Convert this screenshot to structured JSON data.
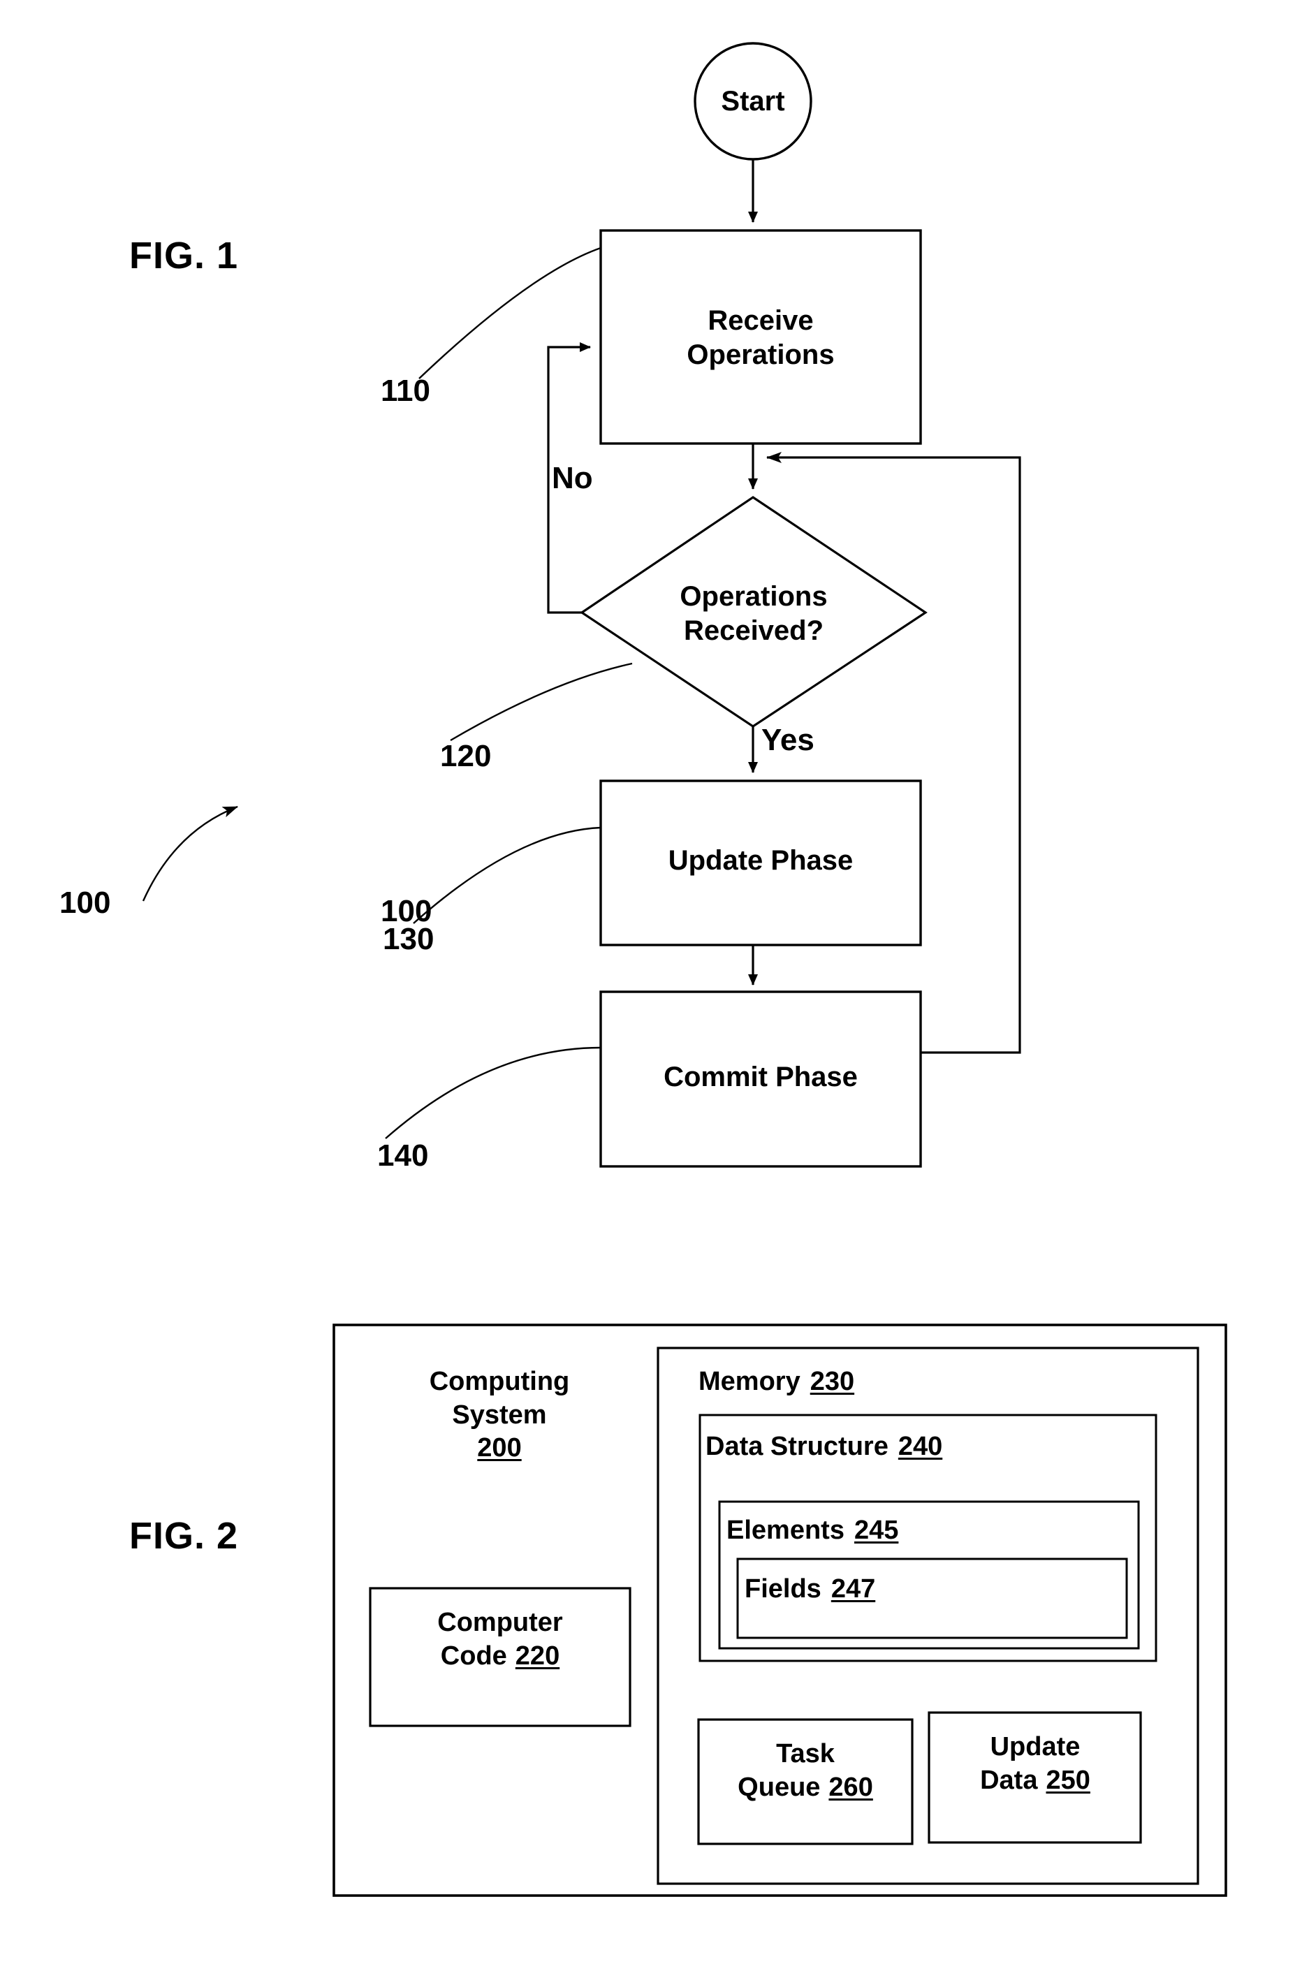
{
  "figures": [
    {
      "label": "FIG. 1",
      "type": "flowchart",
      "overall_ref": "100",
      "nodes": [
        {
          "id": "start",
          "shape": "circle",
          "text": "Start"
        },
        {
          "id": "receive",
          "shape": "rect",
          "text": "Receive\nOperations",
          "ref": "110"
        },
        {
          "id": "decide",
          "shape": "diamond",
          "text": "Operations\nReceived?",
          "ref": "120"
        },
        {
          "id": "update",
          "shape": "rect",
          "text": "Update Phase",
          "ref": "130"
        },
        {
          "id": "commit",
          "shape": "rect",
          "text": "Commit Phase",
          "ref": "140"
        }
      ],
      "edge_labels": {
        "no": "No",
        "yes": "Yes"
      }
    },
    {
      "label": "FIG. 2",
      "type": "block-diagram",
      "blocks": [
        {
          "id": "computing_system",
          "name": "Computing\nSystem",
          "ref": "200"
        },
        {
          "id": "computer_code",
          "name": "Computer\nCode",
          "ref": "220"
        },
        {
          "id": "memory",
          "name": "Memory",
          "ref": "230"
        },
        {
          "id": "data_structure",
          "name": "Data Structure",
          "ref": "240"
        },
        {
          "id": "elements",
          "name": "Elements",
          "ref": "245"
        },
        {
          "id": "fields",
          "name": "Fields",
          "ref": "247"
        },
        {
          "id": "task_queue",
          "name": "Task\nQueue",
          "ref": "260"
        },
        {
          "id": "update_data",
          "name": "Update\nData",
          "ref": "250"
        }
      ]
    }
  ],
  "fig1": {
    "label": "FIG. 1",
    "overall_ref": "100",
    "start_text": "Start",
    "receive_text": "Receive\nOperations",
    "receive_ref": "110",
    "decide_text": "Operations\nReceived?",
    "decide_ref": "120",
    "update_text": "Update Phase",
    "update_ref": "130",
    "commit_text": "Commit Phase",
    "commit_ref": "140",
    "no_label": "No",
    "yes_label": "Yes"
  },
  "fig2": {
    "label": "FIG. 2",
    "computing_system_l1": "Computing",
    "computing_system_l2": "System",
    "computing_system_ref": "200",
    "computer_code_l1": "Computer",
    "computer_code_l2": "Code",
    "computer_code_ref": "220",
    "memory_name": "Memory",
    "memory_ref": "230",
    "data_structure_name": "Data Structure",
    "data_structure_ref": "240",
    "elements_name": "Elements",
    "elements_ref": "245",
    "fields_name": "Fields",
    "fields_ref": "247",
    "task_queue_l1": "Task",
    "task_queue_l2": "Queue",
    "task_queue_ref": "260",
    "update_data_l1": "Update",
    "update_data_l2": "Data",
    "update_data_ref": "250"
  },
  "style": {
    "ink": "#000000",
    "paper": "#ffffff"
  }
}
